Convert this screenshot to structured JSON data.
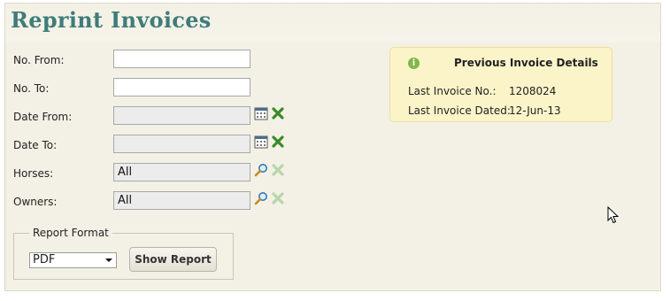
{
  "page": {
    "title": "Reprint Invoices"
  },
  "form": {
    "no_from": {
      "label": "No. From:",
      "value": ""
    },
    "no_to": {
      "label": "No. To:",
      "value": ""
    },
    "date_from": {
      "label": "Date From:",
      "value": ""
    },
    "date_to": {
      "label": "Date To:",
      "value": ""
    },
    "horses": {
      "label": "Horses:",
      "value": "All"
    },
    "owners": {
      "label": "Owners:",
      "value": "All"
    }
  },
  "report_format": {
    "legend": "Report Format",
    "selected": "PDF",
    "button_label": "Show Report"
  },
  "previous_invoice": {
    "title": "Previous Invoice Details",
    "last_no_label": "Last Invoice No.:",
    "last_no_value": "1208024",
    "last_dated_label": "Last Invoice Dated:",
    "last_dated_value": "12-Jun-13"
  },
  "icons": {
    "calendar": "calendar-icon",
    "clear": "clear-x-icon",
    "lookup": "magnifier-icon",
    "info": "info-icon",
    "cursor": "mouse-cursor-icon"
  },
  "colors": {
    "title": "#3f7c7a",
    "panel_bg": "#f3f1e5",
    "info_bg": "#fbf4c9",
    "clear_active": "#3a8a2a",
    "clear_disabled": "#b7d6a9"
  }
}
